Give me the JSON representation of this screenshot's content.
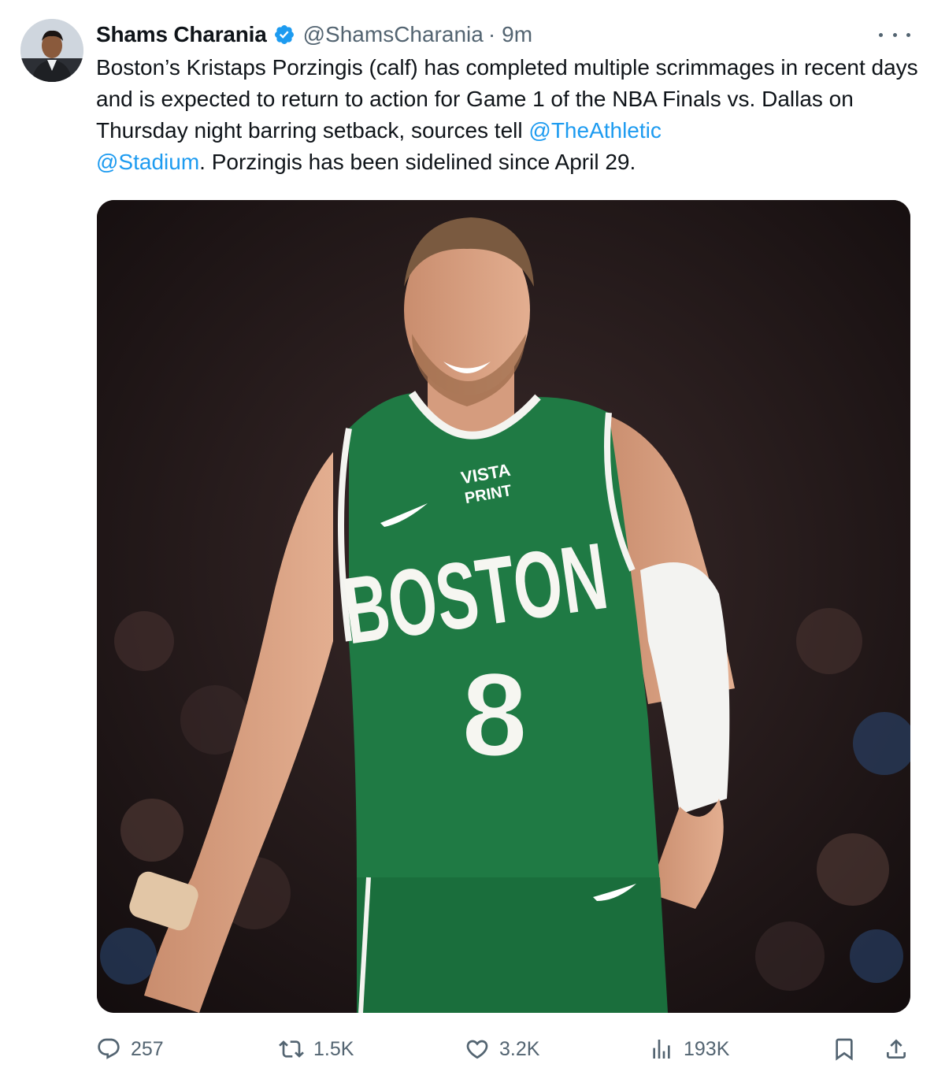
{
  "author": {
    "display_name": "Shams Charania",
    "handle": "@ShamsCharania",
    "separator": "·",
    "time": "9m",
    "verified_icon": "verified-badge-icon"
  },
  "tweet": {
    "text_before": "Boston’s Kristaps Porzingis (calf) has completed multiple scrimmages in recent days and is expected to return to action for Game 1 of the NBA Finals vs. Dallas on Thursday night barring setback, sources tell ",
    "mention_1": "@TheAthletic",
    "mention_2": "@Stadium",
    "text_after": ". Porzingis has been sidelined since April 29."
  },
  "media": {
    "jersey_wordmark": "BOSTON",
    "jersey_number": "8",
    "jersey_sponsor_line1": "VISTA",
    "jersey_sponsor_line2": "PRINT",
    "jersey_color": "#1f7a44"
  },
  "actions": {
    "replies": "257",
    "reposts": "1.5K",
    "likes": "3.2K",
    "views": "193K"
  },
  "colors": {
    "link": "#1d9bf0",
    "muted": "#536471",
    "verified": "#1d9bf0"
  }
}
